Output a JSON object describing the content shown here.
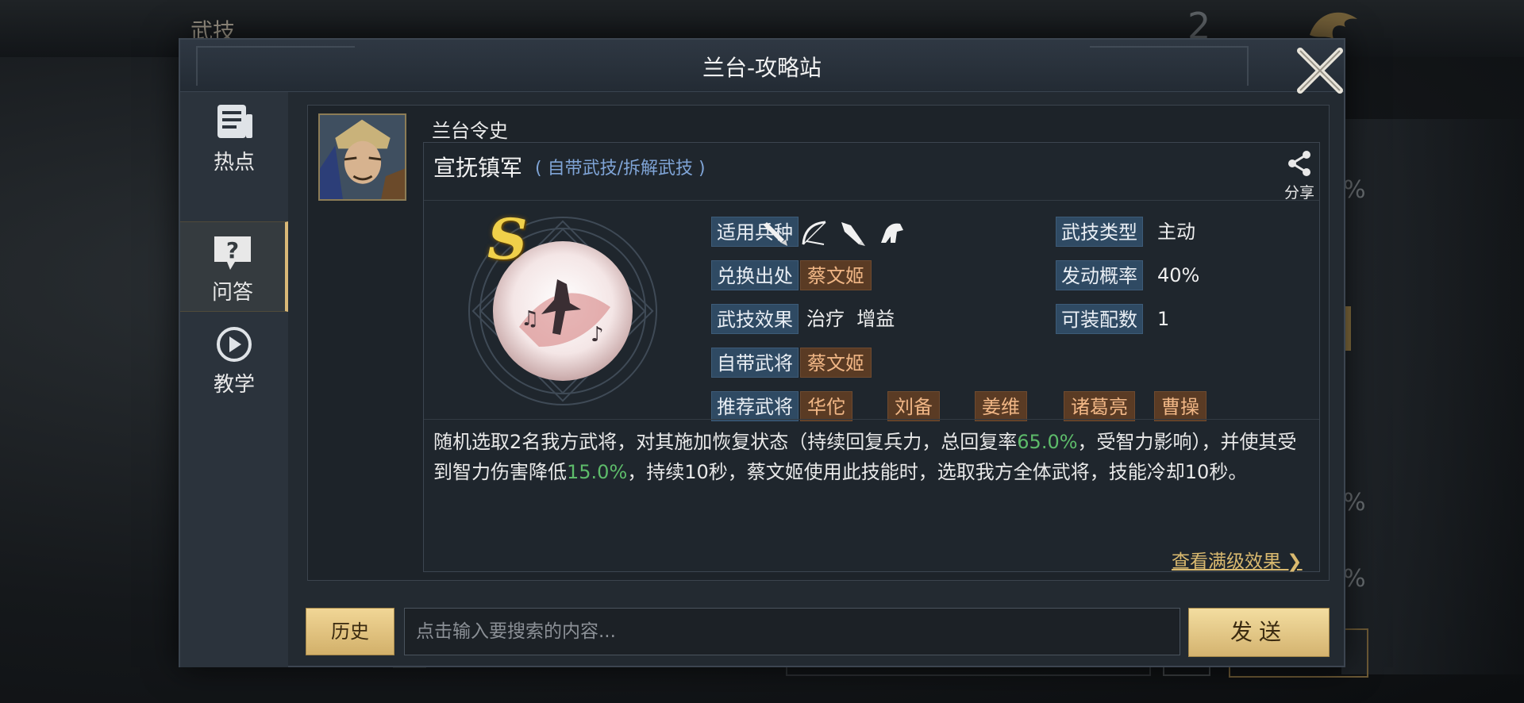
{
  "background": {
    "title": "武技",
    "number": "2",
    "pct_fragments": [
      "%",
      "%",
      "%"
    ]
  },
  "dialog": {
    "title": "兰台-攻略站"
  },
  "sidebar": {
    "items": [
      {
        "label": "热点",
        "icon": "news-icon"
      },
      {
        "label": "问答",
        "icon": "question-icon",
        "active": true
      },
      {
        "label": "教学",
        "icon": "play-icon"
      }
    ]
  },
  "content": {
    "general_name": "兰台令史",
    "skill": {
      "title": "宣抚镇军",
      "subtitle": "( 自带武技/拆解武技 )",
      "grade": "S",
      "share_label": "分享"
    },
    "attributes": {
      "unit_type_label": "适用兵种",
      "unit_icons": [
        "sword-icon",
        "bow-icon",
        "spear-icon",
        "cavalry-icon"
      ],
      "exchange_label": "兑换出处",
      "exchange_value": "蔡文姬",
      "effect_label": "武技效果",
      "effect_value": "治疗  增益",
      "owner_label": "自带武将",
      "owner_value": "蔡文姬",
      "recommend_label": "推荐武将",
      "recommend_values": [
        "华佗",
        "刘备",
        "姜维",
        "诸葛亮",
        "曹操"
      ],
      "type_label": "武技类型",
      "type_value": "主动",
      "rate_label": "发动概率",
      "rate_value": "40%",
      "equip_label": "可装配数",
      "equip_value": "1"
    },
    "description": {
      "part1": "随机选取2名我方武将，对其施加恢复状态（持续回复兵力，总回复率",
      "highlight1": "65.0%",
      "part2": "，受智力影响），并使其受到智力伤害降低",
      "highlight2": "15.0%",
      "part3": "，持续10秒，蔡文姬使用此技能时，选取我方全体武将，技能冷却10秒。"
    },
    "more_link": "查看满级效果 ❯"
  },
  "bottom": {
    "history_label": "历史",
    "search_placeholder": "点击输入要搜索的内容...",
    "search_value": "",
    "send_label": "发送"
  },
  "colors": {
    "accent_gold": "#d9b877",
    "tag_blue": "#2f4a63",
    "chip_brown": "#5a3b24",
    "highlight_green": "#5dbb6a",
    "link_gold": "#d9b96f"
  }
}
